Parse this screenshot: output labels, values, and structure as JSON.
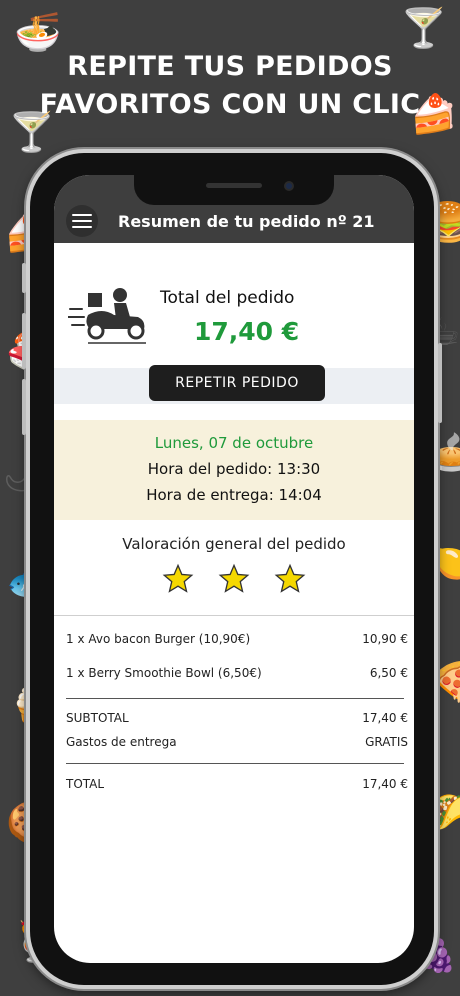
{
  "promo": {
    "line1": "REPITE TUS PEDIDOS",
    "line2": "FAVORITOS CON UN CLIC"
  },
  "header": {
    "title": "Resumen de tu pedido nº 21"
  },
  "order": {
    "total_label": "Total del pedido",
    "total_amount": "17,40 €",
    "repeat_button": "REPETIR PEDIDO",
    "day": "Lunes, 07 de octubre",
    "order_time": "Hora del pedido: 13:30",
    "delivery_time": "Hora de entrega: 14:04"
  },
  "rating": {
    "label": "Valoración general del pedido",
    "stars": 3,
    "max_stars": 3,
    "star_color": "#f5d800"
  },
  "items": [
    {
      "desc": "1 x   Avo bacon Burger (10,90€)",
      "price": "10,90 €"
    },
    {
      "desc": "1 x Berry Smoothie Bowl (6,50€)",
      "price": "6,50 €"
    }
  ],
  "summary": {
    "subtotal_label": "SUBTOTAL",
    "subtotal_value": "17,40 €",
    "delivery_label": "Gastos de entrega",
    "delivery_value": "GRATIS",
    "total_label": "TOTAL",
    "total_value": "17,40 €"
  },
  "colors": {
    "accent_green": "#1f9a3b",
    "header_bg": "#3e3e3e",
    "date_bg": "#f7f1dc"
  },
  "icons": [
    "noodle-bowl-icon",
    "cocktail-icon",
    "cake-icon",
    "menu-icon",
    "delivery-rider-icon",
    "star-icon"
  ]
}
